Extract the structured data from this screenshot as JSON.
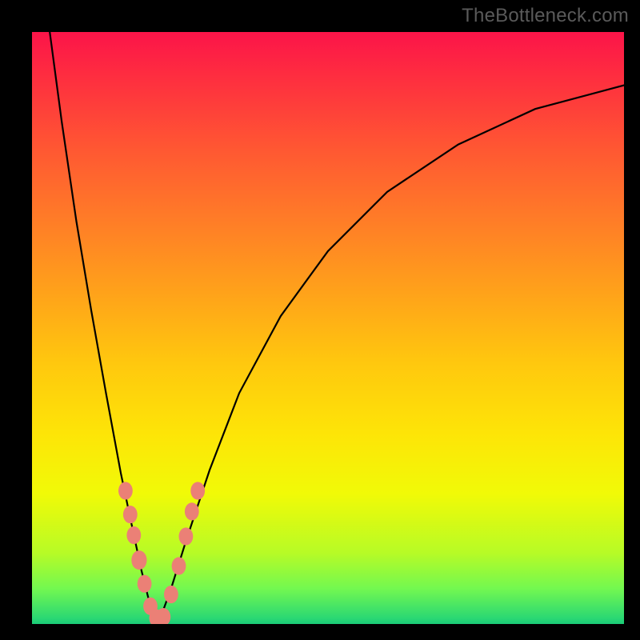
{
  "watermark": "TheBottleneck.com",
  "colors": {
    "frame": "#000000",
    "gradient_top": "#fc1449",
    "gradient_bottom": "#1acb78",
    "curve": "#000000",
    "dots": "#eb8076"
  },
  "chart_data": {
    "type": "line",
    "title": "",
    "xlabel": "",
    "ylabel": "",
    "xlim": [
      0,
      1
    ],
    "ylim": [
      0,
      1
    ],
    "note": "Axes unlabeled in source image; x and y normalized 0–1. y≈0 at curve minimum, y≈1 at top of plot. Curve resembles |log(x/x0)|-style bottleneck profile with minimum near x≈0.21.",
    "series": [
      {
        "name": "curve-left",
        "x": [
          0.03,
          0.05,
          0.075,
          0.1,
          0.125,
          0.15,
          0.17,
          0.185,
          0.2,
          0.21
        ],
        "y": [
          1.0,
          0.85,
          0.68,
          0.53,
          0.39,
          0.255,
          0.16,
          0.09,
          0.03,
          0.005
        ]
      },
      {
        "name": "curve-right",
        "x": [
          0.215,
          0.235,
          0.26,
          0.3,
          0.35,
          0.42,
          0.5,
          0.6,
          0.72,
          0.85,
          1.0
        ],
        "y": [
          0.005,
          0.06,
          0.14,
          0.26,
          0.39,
          0.52,
          0.63,
          0.73,
          0.81,
          0.87,
          0.91
        ]
      }
    ],
    "scatter": {
      "name": "markers",
      "points": [
        {
          "x": 0.158,
          "y": 0.225,
          "r": 0.012
        },
        {
          "x": 0.166,
          "y": 0.185,
          "r": 0.012
        },
        {
          "x": 0.172,
          "y": 0.15,
          "r": 0.012
        },
        {
          "x": 0.181,
          "y": 0.108,
          "r": 0.013
        },
        {
          "x": 0.19,
          "y": 0.068,
          "r": 0.012
        },
        {
          "x": 0.2,
          "y": 0.03,
          "r": 0.012
        },
        {
          "x": 0.21,
          "y": 0.01,
          "r": 0.012
        },
        {
          "x": 0.222,
          "y": 0.012,
          "r": 0.012
        },
        {
          "x": 0.235,
          "y": 0.05,
          "r": 0.012
        },
        {
          "x": 0.248,
          "y": 0.098,
          "r": 0.012
        },
        {
          "x": 0.26,
          "y": 0.148,
          "r": 0.012
        },
        {
          "x": 0.27,
          "y": 0.19,
          "r": 0.012
        },
        {
          "x": 0.28,
          "y": 0.225,
          "r": 0.012
        }
      ]
    }
  }
}
